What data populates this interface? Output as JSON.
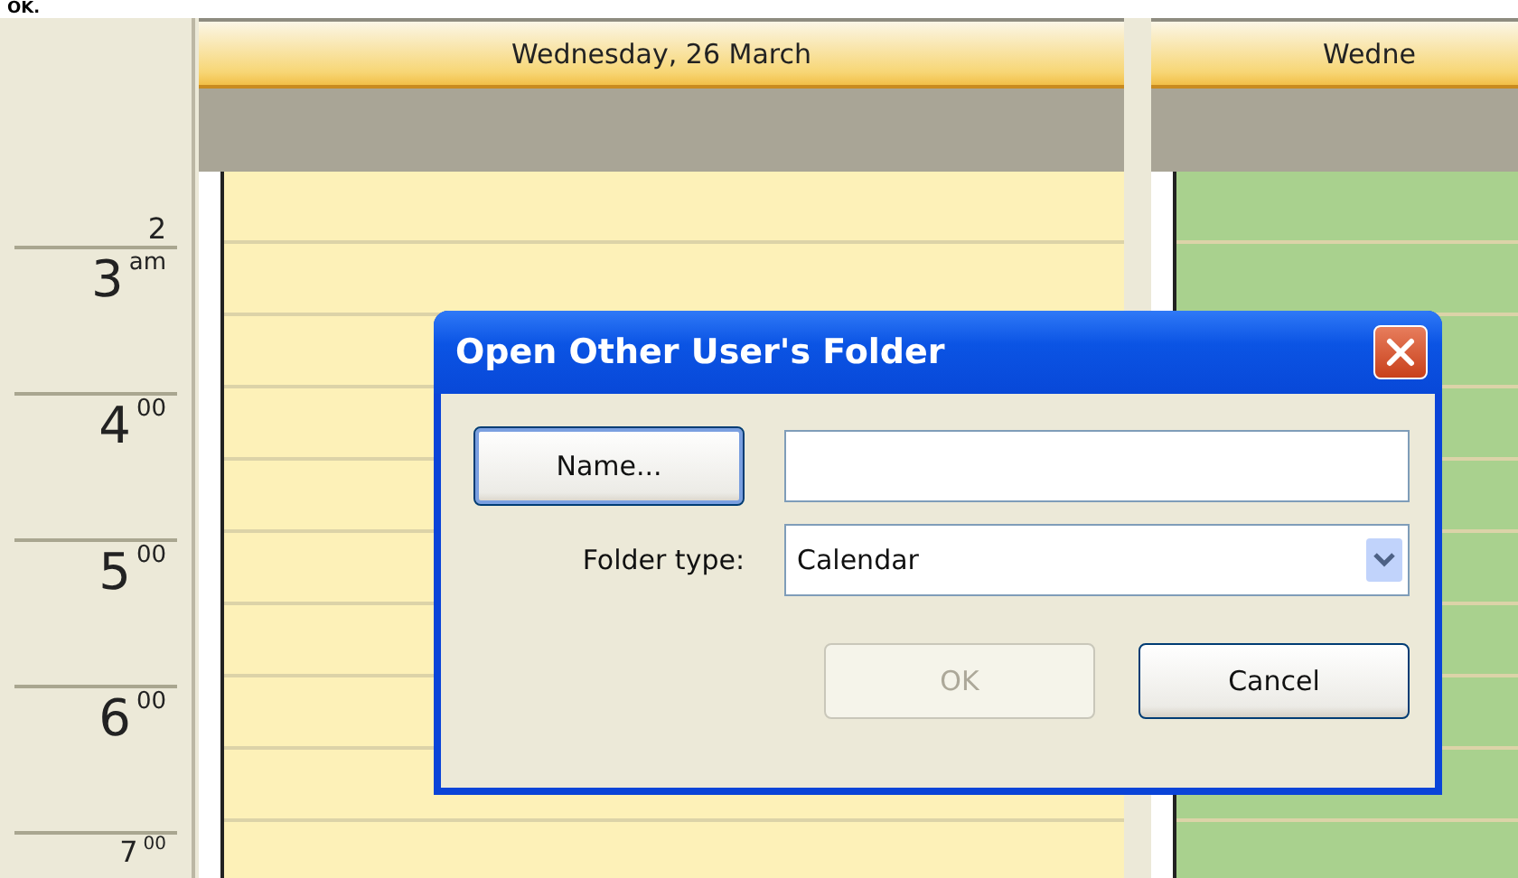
{
  "top_text": "OK.",
  "days": [
    {
      "label": "Wednesday, 26 March",
      "color": "#fdf1b8"
    },
    {
      "label": "Wedne",
      "color": "#a9d18e"
    }
  ],
  "hours": [
    {
      "hour": "2"
    },
    {
      "hour": "3",
      "suffix": "am"
    },
    {
      "hour": "4",
      "suffix": "00"
    },
    {
      "hour": "5",
      "suffix": "00"
    },
    {
      "hour": "6",
      "suffix": "00"
    },
    {
      "hour": "7",
      "suffix": "00"
    }
  ],
  "dialog": {
    "title": "Open Other User's Folder",
    "name_button": "Name...",
    "folder_type": {
      "label": "Folder type:",
      "value": "Calendar"
    },
    "buttons": [
      {
        "label": "OK",
        "disabled": true
      },
      {
        "label": "Cancel",
        "disabled": false
      }
    ]
  }
}
